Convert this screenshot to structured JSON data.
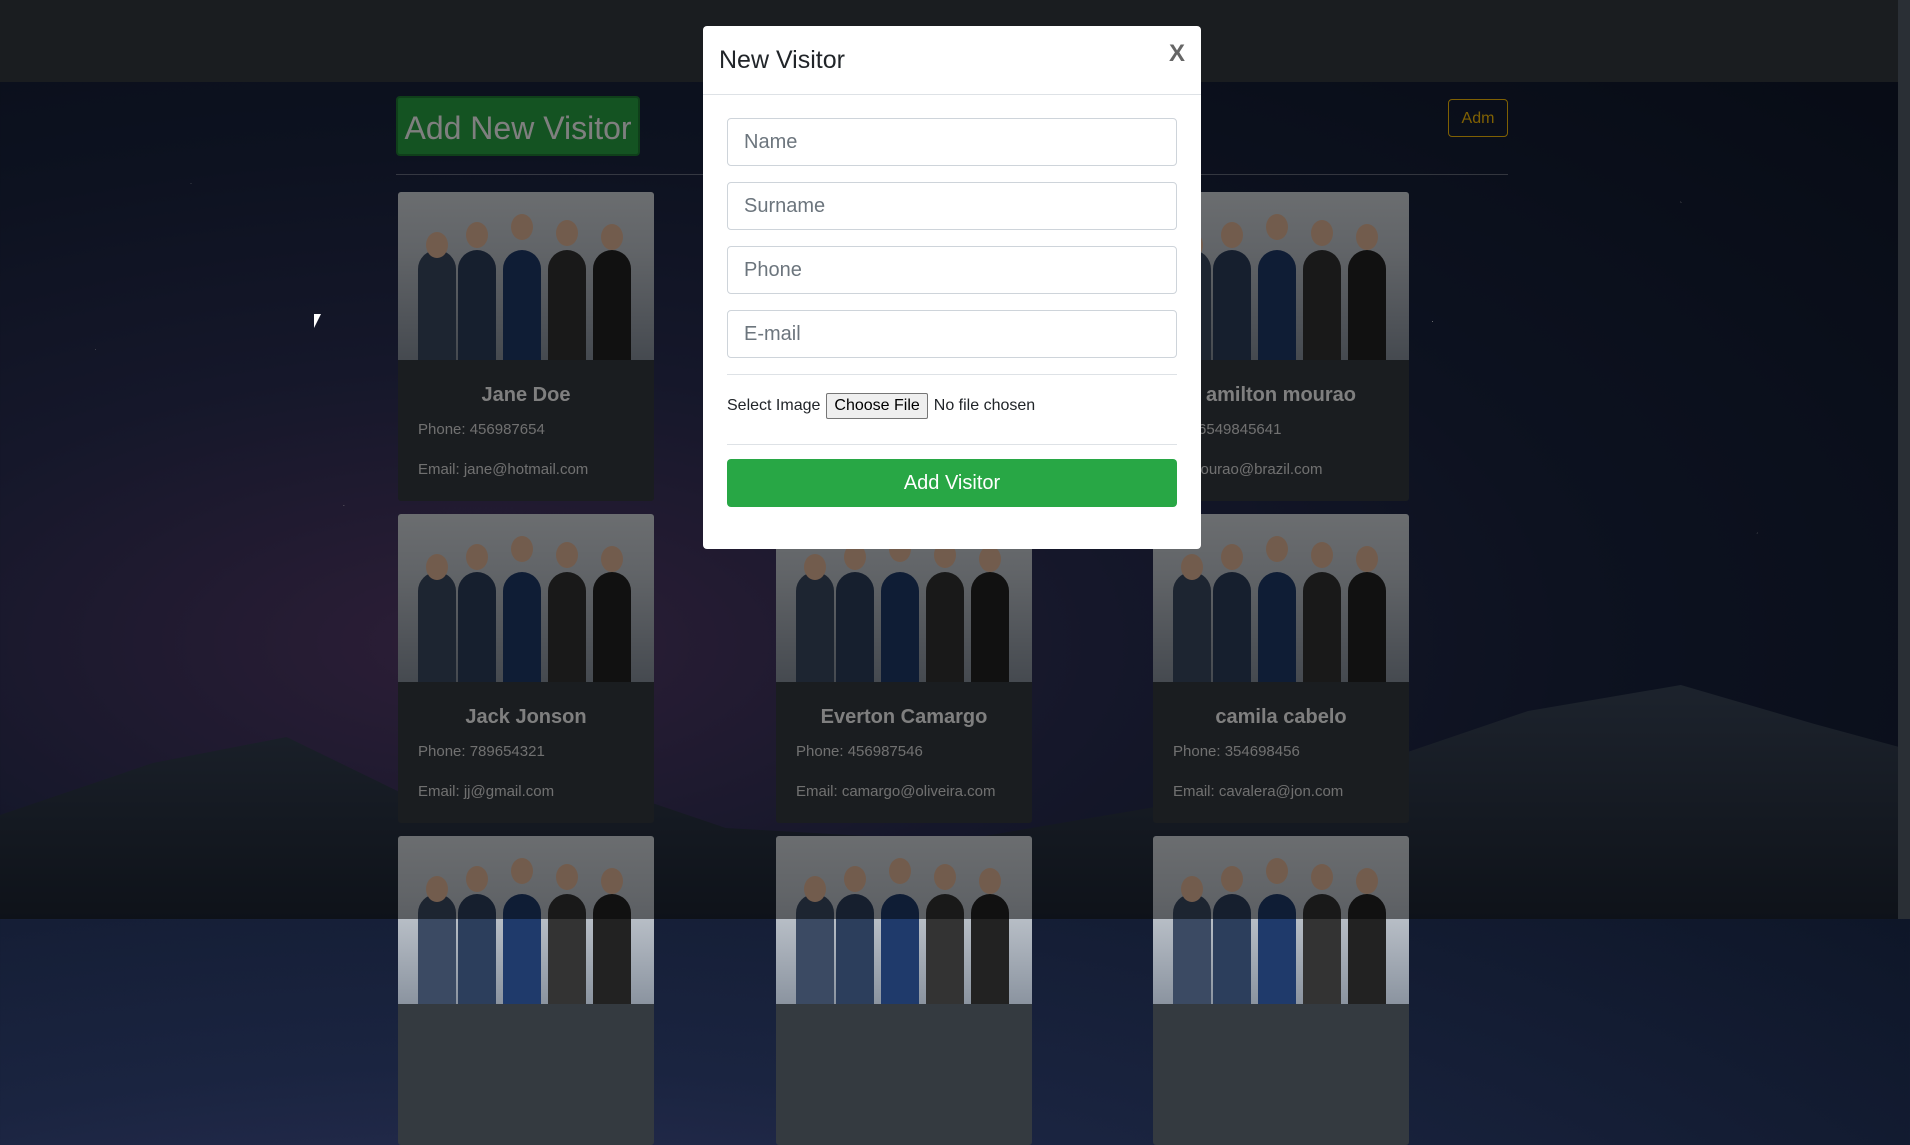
{
  "header": {
    "add_visitor_label": "Add New Visitor",
    "adm_label": "Adm"
  },
  "cards": [
    {
      "name": "Jane Doe",
      "phone": "Phone: 456987654",
      "email": "Email: jane@hotmail.com"
    },
    {
      "name": "",
      "phone": "",
      "email": ""
    },
    {
      "name": "amilton mourao",
      "phone": "ne: 6549845641",
      "email": "il: mourao@brazil.com"
    },
    {
      "name": "Jack Jonson",
      "phone": "Phone: 789654321",
      "email": "Email: jj@gmail.com"
    },
    {
      "name": "Everton Camargo",
      "phone": "Phone: 456987546",
      "email": "Email: camargo@oliveira.com"
    },
    {
      "name": "camila cabelo",
      "phone": "Phone: 354698456",
      "email": "Email: cavalera@jon.com"
    },
    {
      "name": "",
      "phone": "",
      "email": ""
    },
    {
      "name": "",
      "phone": "",
      "email": ""
    },
    {
      "name": "",
      "phone": "",
      "email": ""
    }
  ],
  "modal": {
    "title": "New Visitor",
    "close_label": "X",
    "name_placeholder": "Name",
    "surname_placeholder": "Surname",
    "phone_placeholder": "Phone",
    "email_placeholder": "E-mail",
    "select_image_label": "Select Image",
    "choose_file_label": "Choose File",
    "no_file_label": "No file chosen",
    "submit_label": "Add Visitor"
  },
  "colors": {
    "success": "#28a745",
    "warning": "#ffc107",
    "navbar": "#343a40"
  }
}
